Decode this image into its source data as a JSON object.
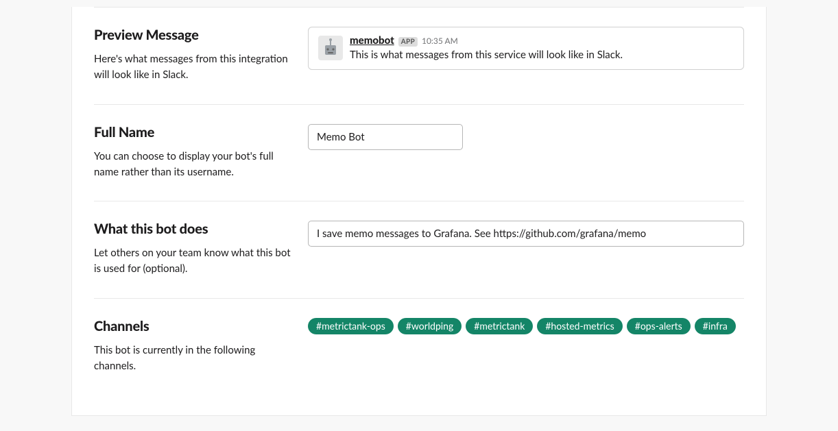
{
  "preview": {
    "title": "Preview Message",
    "desc": "Here's what messages from this integration will look like in Slack.",
    "bot_name": "memobot",
    "badge": "APP",
    "time": "10:35 AM",
    "body": "This is what messages from this service will look like in Slack."
  },
  "fullname": {
    "title": "Full Name",
    "desc": "You can choose to display your bot's full name rather than its username.",
    "value": "Memo Bot"
  },
  "whatdoes": {
    "title": "What this bot does",
    "desc": "Let others on your team know what this bot is used for (optional).",
    "value": "I save memo messages to Grafana. See https://github.com/grafana/memo"
  },
  "channels": {
    "title": "Channels",
    "desc": "This bot is currently in the following channels.",
    "items": [
      "#metrictank-ops",
      "#worldping",
      "#metrictank",
      "#hosted-metrics",
      "#ops-alerts",
      "#infra"
    ]
  }
}
